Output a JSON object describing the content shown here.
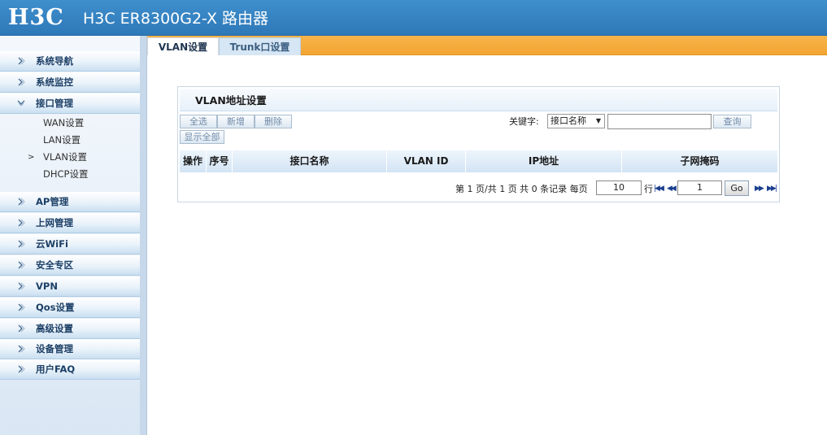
{
  "header": {
    "logo": "H3C",
    "title": "H3C ER8300G2-X 路由器"
  },
  "sidebar": {
    "items": [
      {
        "label": "系统导航",
        "icon": "expand-arrow-icon"
      },
      {
        "label": "系统监控",
        "icon": "expand-arrow-icon"
      },
      {
        "label": "接口管理",
        "icon": "collapse-arrow-icon",
        "children": [
          {
            "label": "WAN设置"
          },
          {
            "label": "LAN设置"
          },
          {
            "label": "VLAN设置",
            "marker": ">"
          },
          {
            "label": "DHCP设置"
          }
        ]
      },
      {
        "label": "AP管理",
        "icon": "expand-arrow-icon"
      },
      {
        "label": "上网管理",
        "icon": "expand-arrow-icon"
      },
      {
        "label": "云WiFi",
        "icon": "expand-arrow-icon"
      },
      {
        "label": "安全专区",
        "icon": "expand-arrow-icon"
      },
      {
        "label": "VPN",
        "icon": "expand-arrow-icon"
      },
      {
        "label": "Qos设置",
        "icon": "expand-arrow-icon"
      },
      {
        "label": "高级设置",
        "icon": "expand-arrow-icon"
      },
      {
        "label": "设备管理",
        "icon": "expand-arrow-icon"
      },
      {
        "label": "用户FAQ",
        "icon": "expand-arrow-icon"
      }
    ]
  },
  "tabs": [
    {
      "label": "VLAN设置",
      "active": true
    },
    {
      "label": "Trunk口设置",
      "active": false
    }
  ],
  "panel": {
    "title": "VLAN地址设置",
    "buttons": {
      "select_all": "全选",
      "add": "新增",
      "delete": "删除",
      "show_all": "显示全部"
    },
    "search": {
      "label": "关键字:",
      "selected_field": "接口名称",
      "value": "",
      "button": "查询"
    },
    "table": {
      "columns": [
        "操作",
        "序号",
        "接口名称",
        "VLAN ID",
        "IP地址",
        "子网掩码"
      ],
      "rows": []
    },
    "pagination": {
      "summary": "第 1 页/共 1 页 共 0 条记录 每页",
      "per_page": "10",
      "rows_suffix": "行",
      "page": "1",
      "go_label": "Go"
    }
  },
  "colors": {
    "header_blue": "#3f8fcd",
    "tab_orange": "#f3a532",
    "accent_link": "#1b3f8f"
  }
}
